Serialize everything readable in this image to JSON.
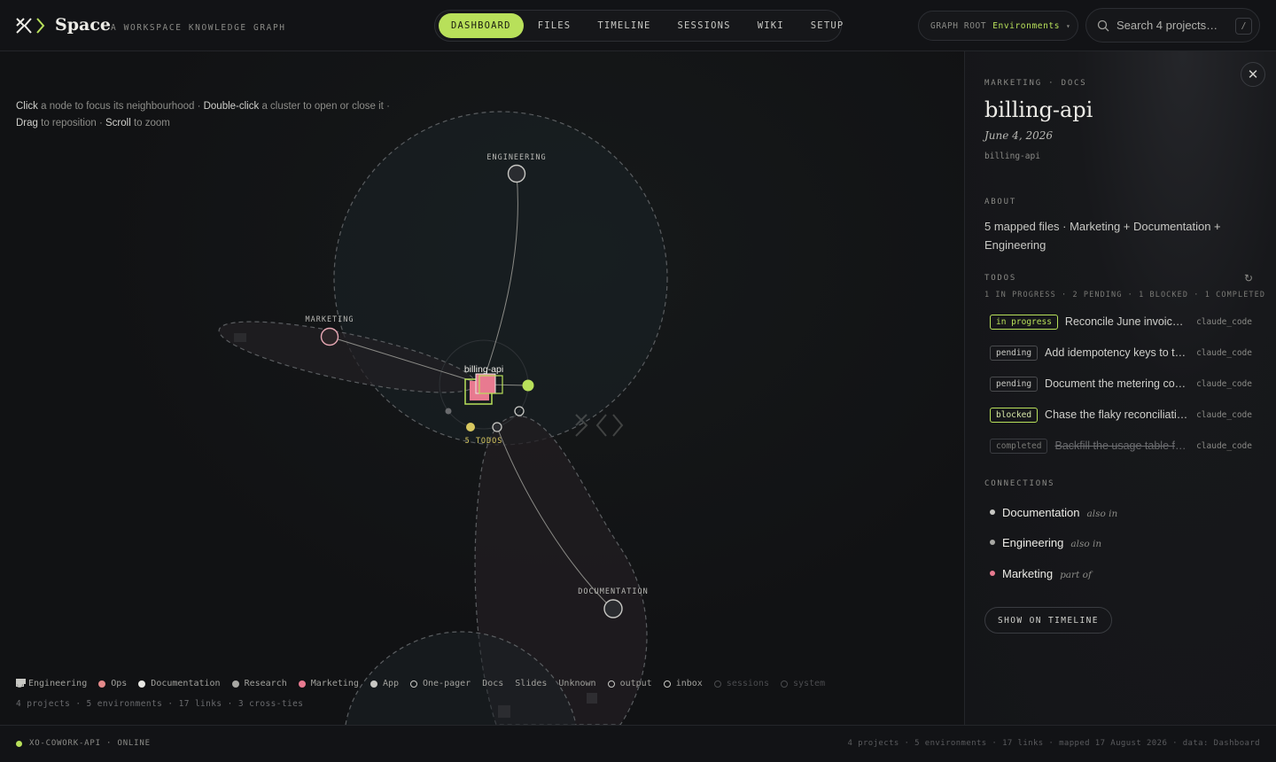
{
  "app": {
    "brand": "Space",
    "tagline": "A WORKSPACE KNOWLEDGE GRAPH"
  },
  "nav": {
    "tabs": [
      "DASHBOARD",
      "FILES",
      "TIMELINE",
      "SESSIONS",
      "WIKI",
      "SETUP"
    ],
    "active": "DASHBOARD"
  },
  "graph_root": {
    "label": "GRAPH ROOT",
    "value": "Environments"
  },
  "search": {
    "placeholder": "Search 4 projects…",
    "shortcut": "/"
  },
  "hint": {
    "click": "Click",
    "click_text": " a node to focus its neighbourhood · ",
    "dbl": "Double-click",
    "dbl_text": " a cluster to open or close it ·",
    "drag": "Drag",
    "drag_text": " to reposition · ",
    "scroll": "Scroll",
    "scroll_text": " to zoom"
  },
  "graph": {
    "clusters": [
      "ENGINEERING",
      "MARKETING",
      "DOCUMENTATION"
    ],
    "focus_label": "billing-api",
    "todos_label": "5 TODOS"
  },
  "legend": {
    "items": [
      {
        "label": "Engineering",
        "color": "#a8a8a4",
        "shape": "dot"
      },
      {
        "label": "Ops",
        "color": "#e48a8a",
        "shape": "dot"
      },
      {
        "label": "Documentation",
        "color": "#e8e8e4",
        "shape": "dot"
      },
      {
        "label": "Research",
        "color": "#a8a8a4",
        "shape": "dot"
      },
      {
        "label": "Marketing",
        "color": "#e87a90",
        "shape": "dot"
      },
      {
        "label": "App",
        "color": "#c8c8c4",
        "shape": "dot"
      },
      {
        "label": "One-pager",
        "color": "#c8c8c4",
        "shape": "ring"
      },
      {
        "label": "Docs",
        "color": "#c8c8c4",
        "shape": "doc"
      },
      {
        "label": "Slides",
        "color": "#c8c8c4",
        "shape": "slide"
      },
      {
        "label": "Unknown",
        "color": "#c8c8c4",
        "shape": "diamond"
      },
      {
        "label": "output",
        "color": "#c8c8c4",
        "shape": "ring"
      },
      {
        "label": "inbox",
        "color": "#c8c8c4",
        "shape": "ring"
      },
      {
        "label": "sessions",
        "color": "#4a4b4e",
        "shape": "ring-dim"
      },
      {
        "label": "system",
        "color": "#4a4b4e",
        "shape": "ring-dim"
      }
    ],
    "stats": "4 projects · 5 environments · 17 links · 3 cross-ties"
  },
  "panel": {
    "eyebrow": "MARKETING · DOCS",
    "title": "billing-api",
    "date": "June 4, 2026",
    "slug": "billing-api",
    "about_label": "ABOUT",
    "about": "5 mapped files · Marketing + Documentation + Engineering",
    "todos_label": "TODOS",
    "todos_summary": "1 IN PROGRESS · 2 PENDING · 1 BLOCKED · 1 COMPLETED",
    "todos": [
      {
        "status": "in progress",
        "text": "Reconcile June invoices …",
        "owner": "claude_code"
      },
      {
        "status": "pending",
        "text": "Add idempotency keys to the…",
        "owner": "claude_code"
      },
      {
        "status": "pending",
        "text": "Document the metering contr…",
        "owner": "claude_code"
      },
      {
        "status": "blocked",
        "text": "Chase the flaky reconciliatio…",
        "owner": "claude_code"
      },
      {
        "status": "completed",
        "text": "Backfill the usage table for…",
        "owner": "claude_code"
      }
    ],
    "connections_label": "CONNECTIONS",
    "connections": [
      {
        "name": "Documentation",
        "relation": "also in",
        "color": "#c8c8c4"
      },
      {
        "name": "Engineering",
        "relation": "also in",
        "color": "#a8a8a4"
      },
      {
        "name": "Marketing",
        "relation": "part of",
        "color": "#e87a90"
      }
    ],
    "timeline_button": "SHOW ON TIMELINE"
  },
  "statusbar": {
    "service": "XO-COWORK-API · ONLINE",
    "status_color": "#b8e05a",
    "summary": "4 projects · 5 environments · 17 links · mapped 17 August 2026 · data: Dashboard"
  }
}
